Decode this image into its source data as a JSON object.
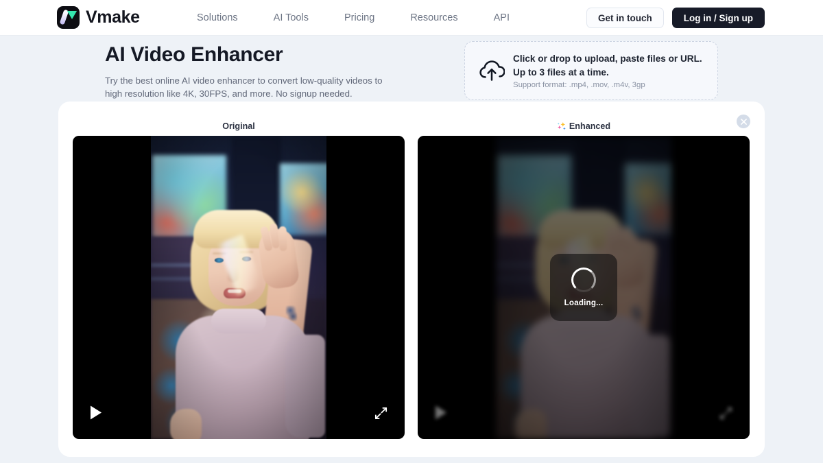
{
  "header": {
    "brand_name": "Vmake",
    "logo_icon": "vmake-logo-icon",
    "nav": [
      {
        "label": "Solutions"
      },
      {
        "label": "AI Tools"
      },
      {
        "label": "Pricing"
      },
      {
        "label": "Resources"
      },
      {
        "label": "API"
      }
    ],
    "contact_label": "Get in touch",
    "auth_label": "Log in / Sign up"
  },
  "hero": {
    "title": "AI Video Enhancer",
    "subtitle": "Try the best online AI video enhancer to convert low-quality videos to high resolution like 4K, 30FPS, and more. No signup needed."
  },
  "upload": {
    "icon": "cloud-upload-icon",
    "line1": "Click or drop to upload, paste files or URL.",
    "line2": "Up to 3 files at a time.",
    "formats": "Support format: .mp4, .mov, .m4v, 3gp"
  },
  "workspace": {
    "close_icon": "close-icon",
    "panels": [
      {
        "label": "Original",
        "has_sparkle": false,
        "state": "ready",
        "play_icon": "play-icon",
        "fullscreen_icon": "fullscreen-expand-icon"
      },
      {
        "label": "Enhanced",
        "has_sparkle": true,
        "sparkle_icon": "sparkles-icon",
        "state": "loading",
        "loading_text": "Loading...",
        "play_icon": "play-icon",
        "fullscreen_icon": "fullscreen-expand-icon"
      }
    ]
  },
  "colors": {
    "page_background": "#eef2f7",
    "card_background": "#ffffff",
    "accent_dark": "#171b28",
    "logo_green": "#35e5ae",
    "logo_lavender": "#bcb4ef",
    "text_primary": "#151925",
    "text_muted": "#6d7585",
    "video_background": "#000000"
  }
}
